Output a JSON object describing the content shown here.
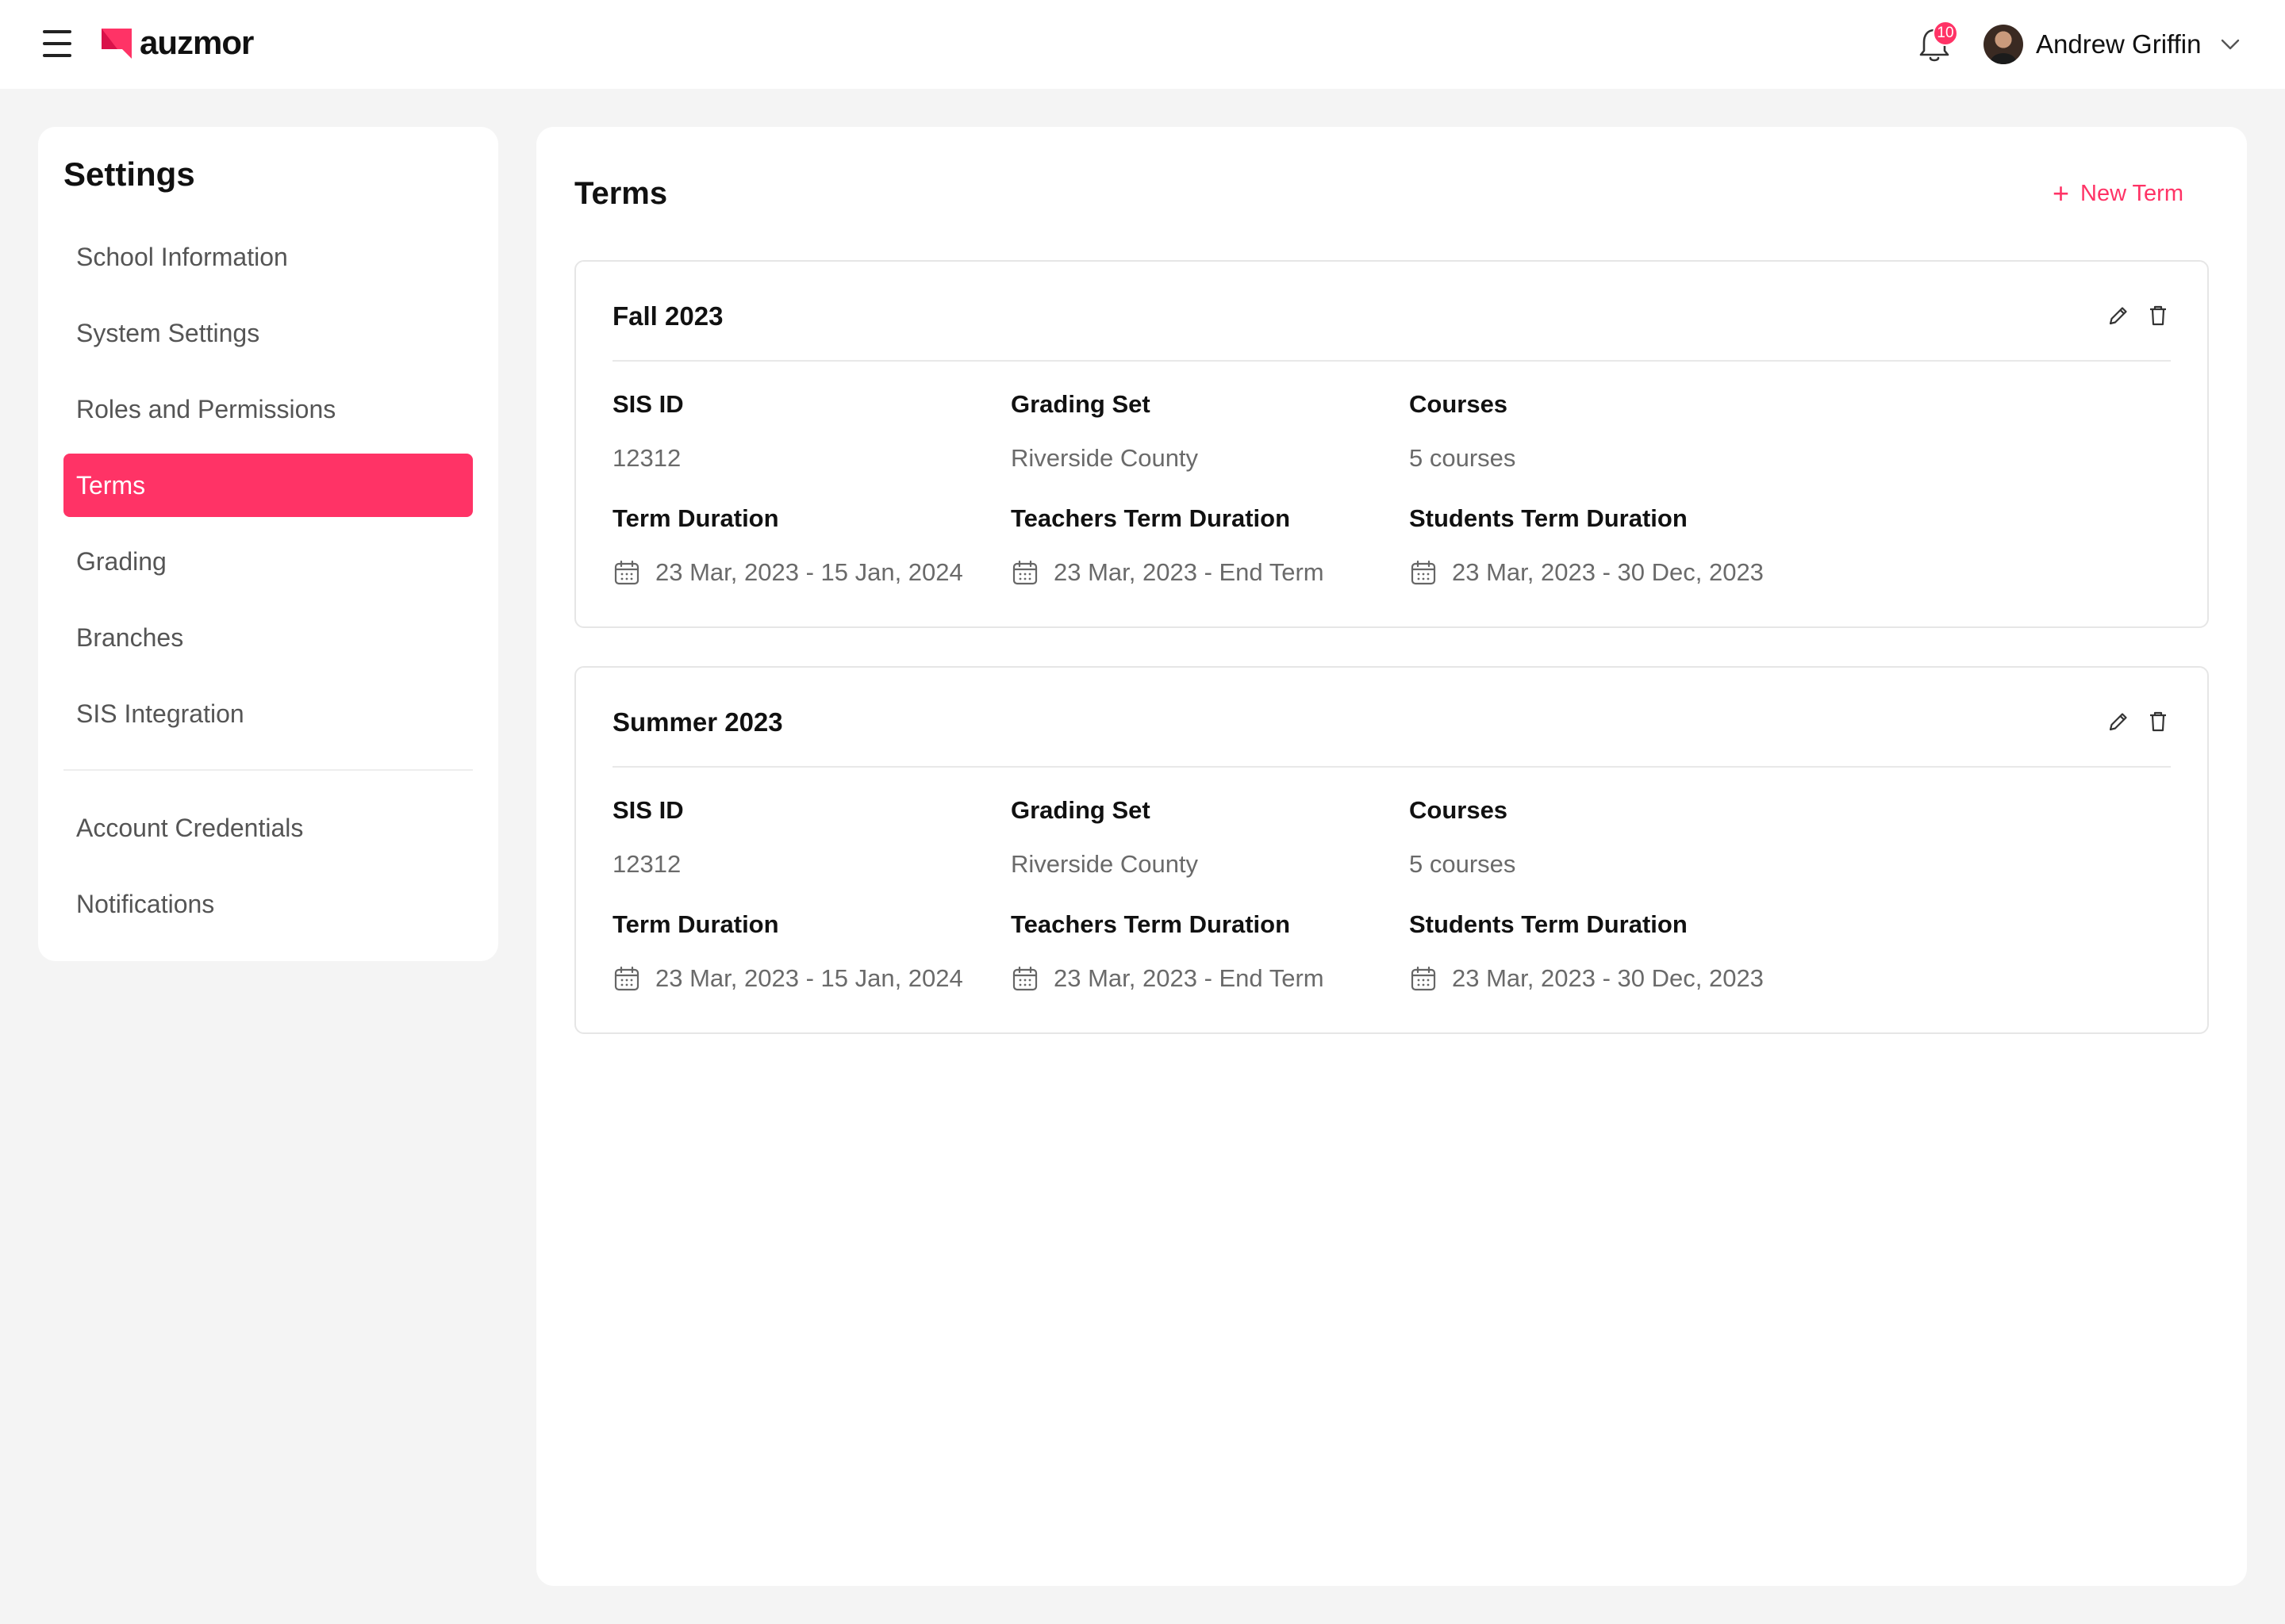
{
  "header": {
    "logo_text": "auzmor",
    "notification_count": "10",
    "user_name": "Andrew Griffin",
    "brand_color": "#ff3366"
  },
  "sidebar": {
    "title": "Settings",
    "items": [
      {
        "label": "School Information"
      },
      {
        "label": "System Settings"
      },
      {
        "label": "Roles and Permissions"
      },
      {
        "label": "Terms",
        "active": true
      },
      {
        "label": "Grading"
      },
      {
        "label": "Branches"
      },
      {
        "label": "SIS Integration"
      },
      {
        "label": "Account Credentials"
      },
      {
        "label": "Notifications"
      }
    ]
  },
  "main": {
    "title": "Terms",
    "new_term_label": "New Term",
    "terms": [
      {
        "name": "Fall 2023",
        "sis_id_label": "SIS ID",
        "sis_id": "12312",
        "grading_set_label": "Grading Set",
        "grading_set": "Riverside County",
        "courses_label": "Courses",
        "courses": "5 courses",
        "term_duration_label": "Term Duration",
        "term_duration": "23 Mar, 2023 - 15 Jan, 2024",
        "teachers_duration_label": "Teachers Term Duration",
        "teachers_duration": "23 Mar, 2023 - End Term",
        "students_duration_label": "Students Term Duration",
        "students_duration": "23 Mar, 2023 - 30 Dec, 2023"
      },
      {
        "name": "Summer 2023",
        "sis_id_label": "SIS ID",
        "sis_id": "12312",
        "grading_set_label": "Grading Set",
        "grading_set": "Riverside County",
        "courses_label": "Courses",
        "courses": "5 courses",
        "term_duration_label": "Term Duration",
        "term_duration": "23 Mar, 2023 - 15 Jan, 2024",
        "teachers_duration_label": "Teachers Term Duration",
        "teachers_duration": "23 Mar, 2023 - End Term",
        "students_duration_label": "Students Term Duration",
        "students_duration": "23 Mar, 2023 - 30 Dec, 2023"
      }
    ]
  }
}
